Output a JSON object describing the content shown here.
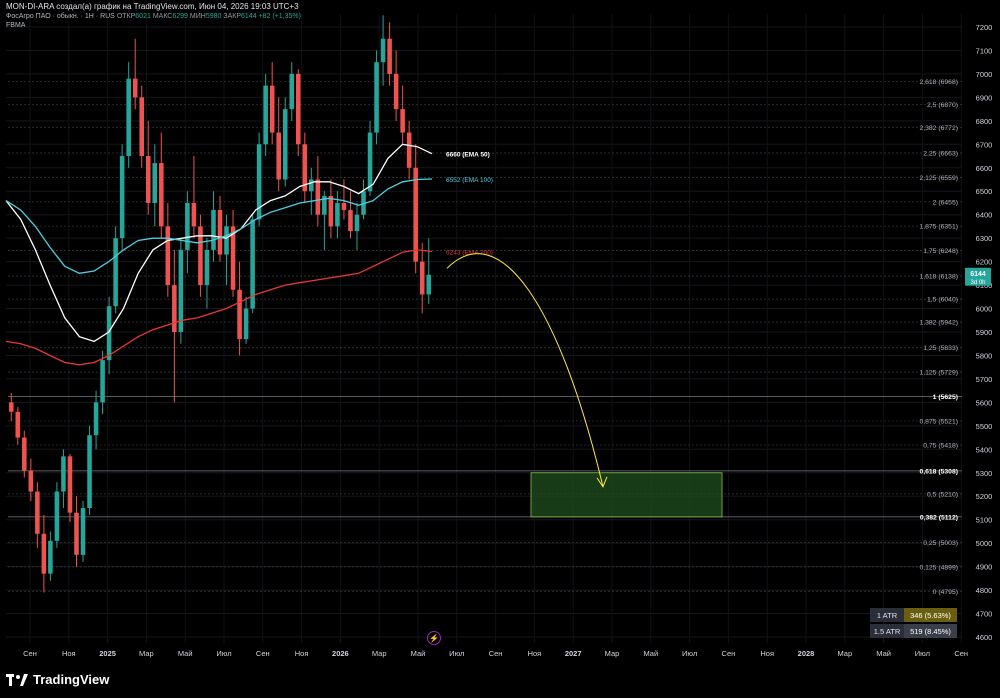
{
  "header": {
    "line1": "MON-DI-ARA создал(а) график на TradingView.com, Июн 04, 2026 19:03 UTC+3",
    "symbol": "ФосАгро ПАО · обыкн. · 1H · RUS",
    "open_label": "ОТКР",
    "open_value": "6021",
    "high_label": "МАКС",
    "high_value": "6299",
    "low_label": "МИН",
    "low_value": "5980",
    "close_label": "ЗАКР",
    "close_value": "6144",
    "change": "+82 (+1,35%)",
    "indicator": "FBMA"
  },
  "price_tag": {
    "value": "6144",
    "sub": "3d 0h",
    "color": "#26a69a"
  },
  "atr": [
    {
      "label": "1 ATR",
      "value": "346 (5.63%)",
      "bg": "#6b5e0f"
    },
    {
      "label": "1.5 ATR",
      "value": "519 (8.45%)",
      "bg": "#3a3d4a"
    }
  ],
  "footer": {
    "brand": "TradingView"
  },
  "colors": {
    "up": "#26a69a",
    "down": "#ef5350",
    "ema50": "#ffffff",
    "ema100": "#4dd0e1",
    "ema200": "#e53935",
    "arrow": "#ffeb3b",
    "zone_fill": "#1f4d1f",
    "zone_border": "#8bc34a"
  },
  "chart_data": {
    "type": "candlestick",
    "title": "ФосАгро ПАО · обыкн. · 1H · RUS",
    "x_ticks": [
      "Сен",
      "Ноя",
      "2025",
      "Мар",
      "Май",
      "Июл",
      "Сен",
      "Ноя",
      "2026",
      "Мар",
      "Май",
      "Июл",
      "Сен",
      "Ноя",
      "2027",
      "Мар",
      "Май",
      "Июл",
      "Сен",
      "Ноя",
      "2028",
      "Мар",
      "Май",
      "Июл",
      "Сен"
    ],
    "y_ticks": [
      4600,
      4700,
      4800,
      4900,
      5000,
      5100,
      5200,
      5300,
      5400,
      5500,
      5600,
      5700,
      5800,
      5900,
      6000,
      6100,
      6200,
      6300,
      6400,
      6500,
      6600,
      6700,
      6800,
      6900,
      7000,
      7100,
      7200
    ],
    "ylim": [
      4560,
      7250
    ],
    "last_price": 6144,
    "series": [
      {
        "name": "EMA 50",
        "last_value": 6660,
        "label": "6660 (EMA 50)",
        "values": [
          6460,
          6380,
          6250,
          6100,
          5960,
          5880,
          5860,
          5900,
          6000,
          6150,
          6250,
          6290,
          6300,
          6310,
          6310,
          6300,
          6340,
          6420,
          6460,
          6480,
          6520,
          6540,
          6540,
          6520,
          6490,
          6530,
          6640,
          6700,
          6690,
          6660
        ]
      },
      {
        "name": "EMA 100",
        "last_value": 6552,
        "label": "6552 (EMA 100)",
        "values": [
          6460,
          6420,
          6350,
          6260,
          6180,
          6150,
          6160,
          6200,
          6250,
          6290,
          6300,
          6300,
          6290,
          6280,
          6290,
          6310,
          6340,
          6380,
          6410,
          6430,
          6450,
          6460,
          6470,
          6460,
          6440,
          6460,
          6510,
          6540,
          6550,
          6552
        ]
      },
      {
        "name": "EMA 200",
        "last_value": 6243,
        "label": "6243 (EMA 200)",
        "values": [
          5860,
          5850,
          5830,
          5800,
          5770,
          5760,
          5770,
          5800,
          5840,
          5880,
          5910,
          5930,
          5950,
          5960,
          5980,
          6000,
          6030,
          6060,
          6080,
          6100,
          6110,
          6120,
          6130,
          6140,
          6150,
          6180,
          6210,
          6240,
          6250,
          6243
        ]
      }
    ],
    "ohlc": [
      [
        5600,
        5640,
        5520,
        5560
      ],
      [
        5560,
        5580,
        5420,
        5450
      ],
      [
        5450,
        5480,
        5280,
        5310
      ],
      [
        5310,
        5360,
        5180,
        5220
      ],
      [
        5220,
        5260,
        4980,
        5040
      ],
      [
        5040,
        5120,
        4790,
        4870
      ],
      [
        4870,
        5050,
        4840,
        5010
      ],
      [
        5010,
        5260,
        4980,
        5220
      ],
      [
        5220,
        5400,
        5150,
        5370
      ],
      [
        5370,
        5380,
        5090,
        5130
      ],
      [
        5130,
        5200,
        4900,
        4950
      ],
      [
        4950,
        5180,
        4920,
        5150
      ],
      [
        5150,
        5500,
        5120,
        5460
      ],
      [
        5460,
        5650,
        5400,
        5600
      ],
      [
        5600,
        5820,
        5550,
        5780
      ],
      [
        5780,
        6050,
        5720,
        6010
      ],
      [
        6010,
        6350,
        5980,
        6300
      ],
      [
        6300,
        6700,
        6250,
        6650
      ],
      [
        6650,
        7050,
        6600,
        6980
      ],
      [
        6980,
        7150,
        6850,
        6900
      ],
      [
        6900,
        6950,
        6600,
        6650
      ],
      [
        6650,
        6800,
        6400,
        6450
      ],
      [
        6450,
        6700,
        6350,
        6620
      ],
      [
        6620,
        6750,
        6300,
        6350
      ],
      [
        6350,
        6450,
        6050,
        6100
      ],
      [
        6100,
        6250,
        5600,
        5900
      ],
      [
        5900,
        6300,
        5850,
        6250
      ],
      [
        6250,
        6500,
        6150,
        6450
      ],
      [
        6450,
        6650,
        6300,
        6350
      ],
      [
        6350,
        6400,
        6050,
        6100
      ],
      [
        6100,
        6300,
        6000,
        6250
      ],
      [
        6250,
        6500,
        6200,
        6420
      ],
      [
        6420,
        6480,
        6200,
        6230
      ],
      [
        6230,
        6400,
        6100,
        6350
      ],
      [
        6350,
        6420,
        6050,
        6080
      ],
      [
        6080,
        6200,
        5800,
        5870
      ],
      [
        5870,
        6050,
        5850,
        6000
      ],
      [
        6000,
        6400,
        5980,
        6380
      ],
      [
        6380,
        6750,
        6350,
        6700
      ],
      [
        6700,
        7000,
        6650,
        6950
      ],
      [
        6950,
        7050,
        6700,
        6750
      ],
      [
        6750,
        6900,
        6500,
        6550
      ],
      [
        6550,
        6900,
        6520,
        6850
      ],
      [
        6850,
        7050,
        6800,
        7000
      ],
      [
        7000,
        7020,
        6650,
        6700
      ],
      [
        6700,
        6750,
        6450,
        6500
      ],
      [
        6500,
        6600,
        6400,
        6550
      ],
      [
        6550,
        6650,
        6350,
        6400
      ],
      [
        6400,
        6500,
        6250,
        6480
      ],
      [
        6480,
        6550,
        6300,
        6350
      ],
      [
        6350,
        6500,
        6300,
        6450
      ],
      [
        6450,
        6550,
        6380,
        6420
      ],
      [
        6420,
        6500,
        6300,
        6330
      ],
      [
        6330,
        6450,
        6250,
        6400
      ],
      [
        6400,
        6550,
        6380,
        6500
      ],
      [
        6500,
        6800,
        6480,
        6750
      ],
      [
        6750,
        7100,
        6700,
        7050
      ],
      [
        7050,
        7250,
        6950,
        7150
      ],
      [
        7150,
        7220,
        6950,
        7000
      ],
      [
        7000,
        7100,
        6800,
        6850
      ],
      [
        6850,
        6950,
        6700,
        6750
      ],
      [
        6750,
        6800,
        6550,
        6600
      ],
      [
        6600,
        6700,
        6150,
        6200
      ],
      [
        6200,
        6280,
        5980,
        6060
      ],
      [
        6060,
        6299,
        6020,
        6144
      ]
    ],
    "fibonacci": {
      "levels": [
        {
          "ratio": "0",
          "price": 4795,
          "label": "0 (4795)"
        },
        {
          "ratio": "0,125",
          "price": 4899,
          "label": "0,125 (4899)"
        },
        {
          "ratio": "0,25",
          "price": 5003,
          "label": "0,25 (5003)"
        },
        {
          "ratio": "0,382",
          "price": 5112,
          "label": "0,382 (5112)",
          "bold": true
        },
        {
          "ratio": "0,5",
          "price": 5210,
          "label": "0,5 (5210)"
        },
        {
          "ratio": "0,618",
          "price": 5308,
          "label": "0,618 (5308)",
          "bold": true
        },
        {
          "ratio": "0,75",
          "price": 5418,
          "label": "0,75 (5418)"
        },
        {
          "ratio": "0,875",
          "price": 5521,
          "label": "0,875 (5521)"
        },
        {
          "ratio": "1",
          "price": 5625,
          "label": "1 (5625)",
          "bold": true
        },
        {
          "ratio": "1,125",
          "price": 5729,
          "label": "1,125 (5729)"
        },
        {
          "ratio": "1,25",
          "price": 5833,
          "label": "1,25 (5833)"
        },
        {
          "ratio": "1,382",
          "price": 5942,
          "label": "1,382 (5942)"
        },
        {
          "ratio": "1,5",
          "price": 6040,
          "label": "1,5 (6040)"
        },
        {
          "ratio": "1,618",
          "price": 6138,
          "label": "1,618 (6138)"
        },
        {
          "ratio": "1,75",
          "price": 6248,
          "label": "1,75 (6248)"
        },
        {
          "ratio": "1,875",
          "price": 6351,
          "label": "1,875 (6351)"
        },
        {
          "ratio": "2",
          "price": 6455,
          "label": "2 (6455)"
        },
        {
          "ratio": "2,125",
          "price": 6559,
          "label": "2,125 (6559)"
        },
        {
          "ratio": "2,25",
          "price": 6663,
          "label": "2,25 (6663)"
        },
        {
          "ratio": "2,382",
          "price": 6772,
          "label": "2,382 (6772)"
        },
        {
          "ratio": "2,5",
          "price": 6870,
          "label": "2,5 (6870)"
        },
        {
          "ratio": "2,618",
          "price": 6968,
          "label": "2,618 (6968)"
        }
      ]
    },
    "target_zone": {
      "price_high": 5300,
      "price_low": 5112
    },
    "projection_arrow": {
      "from_price": 6180,
      "to_price": 5240
    }
  }
}
